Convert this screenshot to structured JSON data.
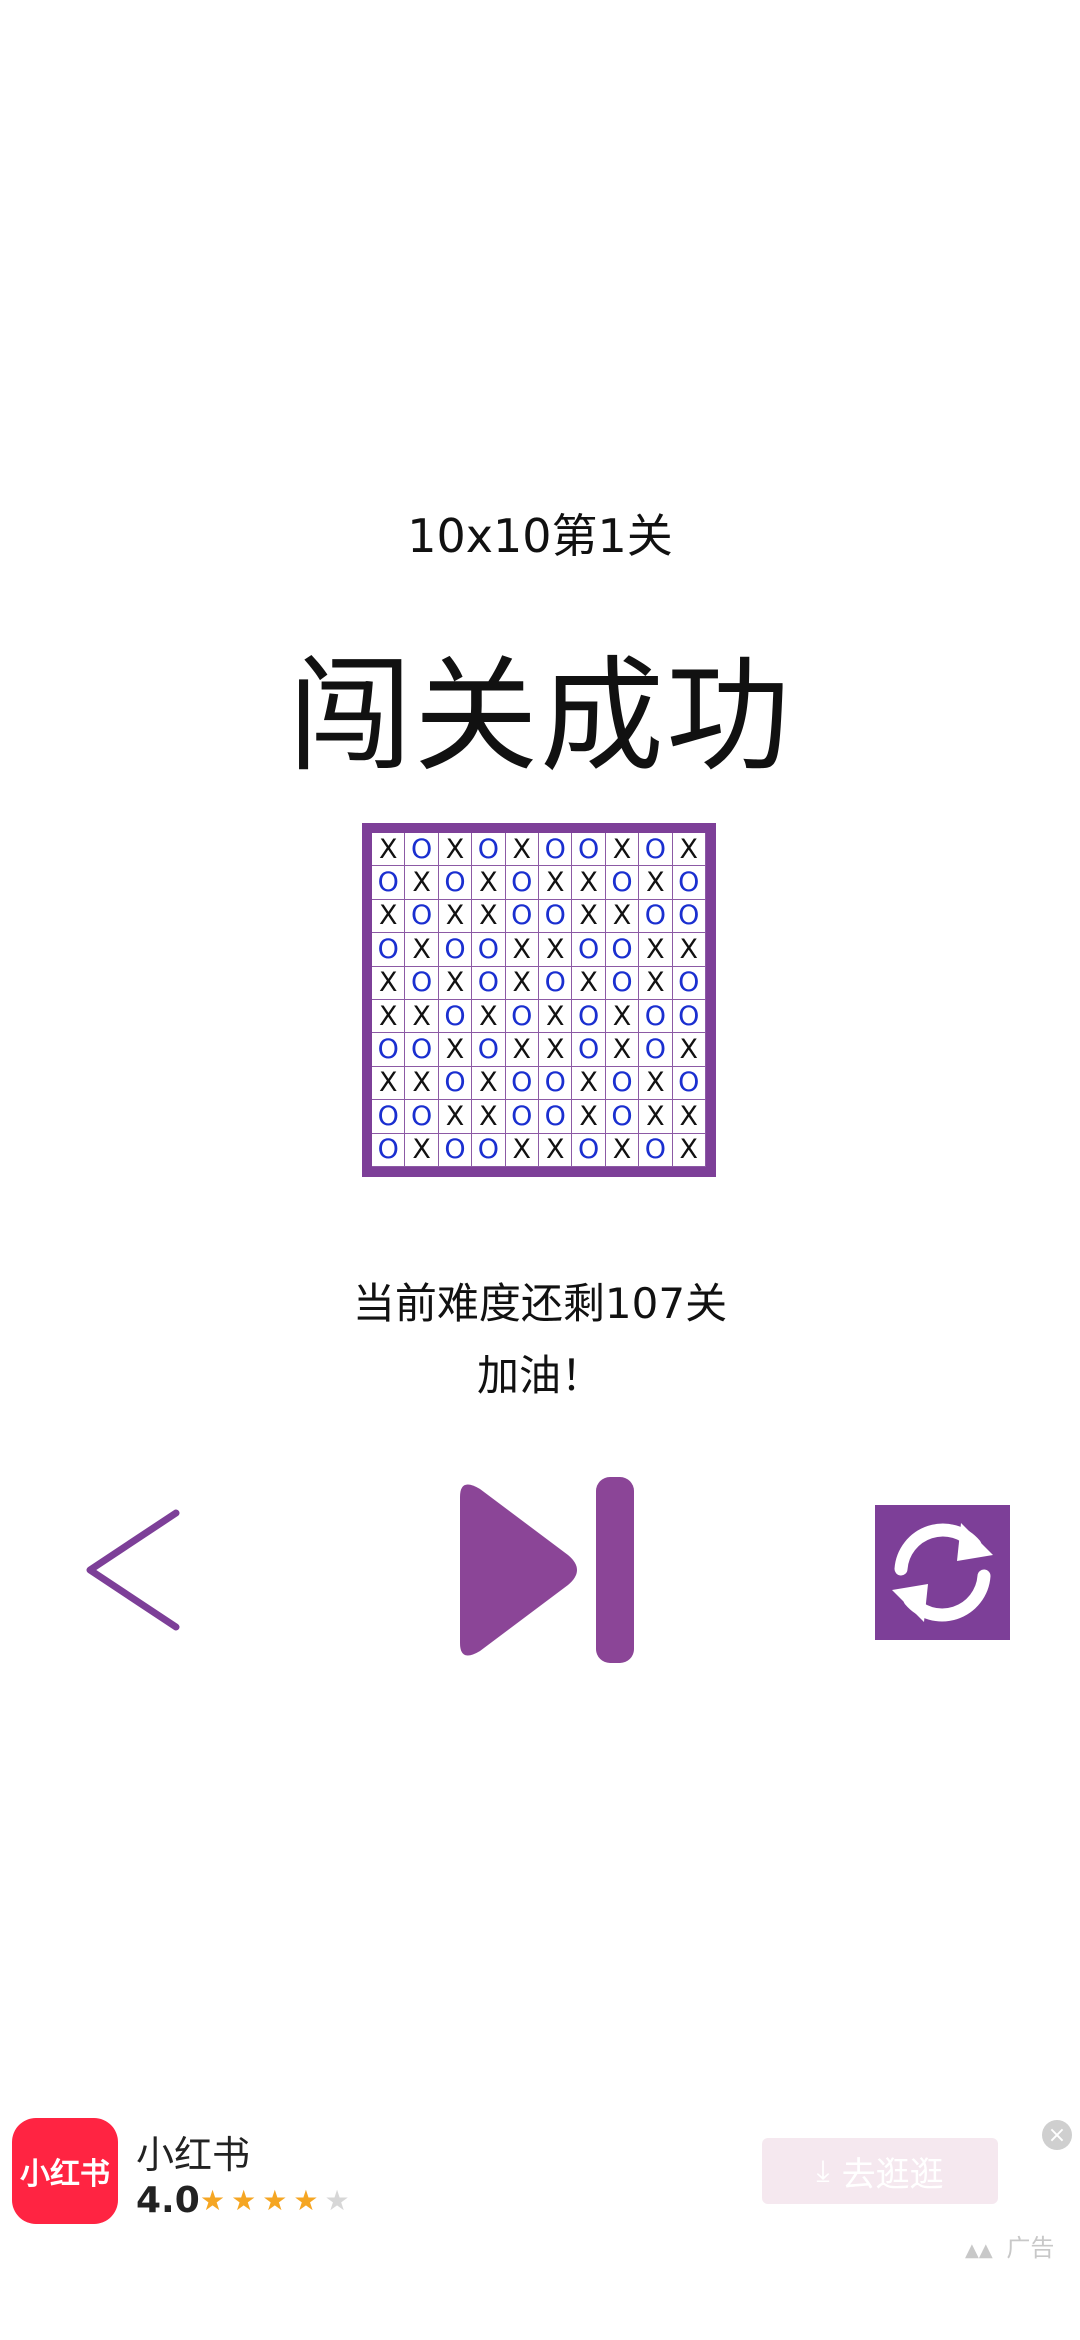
{
  "header": {
    "level_title": "10x10第1关",
    "result_title": "闯关成功"
  },
  "board": {
    "size": 10,
    "border_color": "#7d3f98",
    "x_color": "#111111",
    "o_color": "#1a2fd0",
    "rows": [
      [
        "X",
        "O",
        "X",
        "O",
        "X",
        "O",
        "O",
        "X",
        "O",
        "X"
      ],
      [
        "O",
        "X",
        "O",
        "X",
        "O",
        "X",
        "X",
        "O",
        "X",
        "O"
      ],
      [
        "X",
        "O",
        "X",
        "X",
        "O",
        "O",
        "X",
        "X",
        "O",
        "O"
      ],
      [
        "O",
        "X",
        "O",
        "O",
        "X",
        "X",
        "O",
        "O",
        "X",
        "X"
      ],
      [
        "X",
        "O",
        "X",
        "O",
        "X",
        "O",
        "X",
        "O",
        "X",
        "O"
      ],
      [
        "X",
        "X",
        "O",
        "X",
        "O",
        "X",
        "O",
        "X",
        "O",
        "O"
      ],
      [
        "O",
        "O",
        "X",
        "O",
        "X",
        "X",
        "O",
        "X",
        "O",
        "X"
      ],
      [
        "X",
        "X",
        "O",
        "X",
        "O",
        "O",
        "X",
        "O",
        "X",
        "O"
      ],
      [
        "O",
        "O",
        "X",
        "X",
        "O",
        "O",
        "X",
        "O",
        "X",
        "X"
      ],
      [
        "O",
        "X",
        "O",
        "O",
        "X",
        "X",
        "O",
        "X",
        "O",
        "X"
      ]
    ]
  },
  "message": {
    "remaining": "当前难度还剩107关",
    "cheer": "加油！"
  },
  "controls": {
    "prev_icon": "chevron-left-icon",
    "next_icon": "skip-next-icon",
    "refresh_icon": "refresh-icon",
    "accent_color": "#7d3f98"
  },
  "ad": {
    "logo_text": "小红书",
    "app_name": "小红书",
    "rating": "4.0",
    "stars_filled": 4,
    "stars_total": 5,
    "button_label": "去逛逛",
    "tag_label": "广告",
    "brand_color": "#ff2442"
  }
}
